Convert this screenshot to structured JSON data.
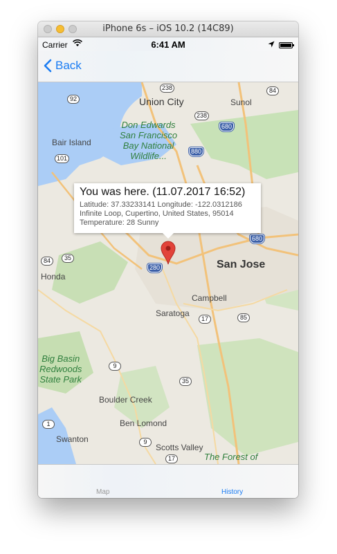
{
  "window": {
    "title": "iPhone 6s – iOS 10.2 (14C89)"
  },
  "status_bar": {
    "carrier": "Carrier",
    "time": "6:41 AM",
    "icons": [
      "wifi-icon",
      "location-arrow-icon",
      "battery-icon"
    ]
  },
  "nav": {
    "back_label": "Back",
    "accent_color": "#1a7cf3"
  },
  "map": {
    "labels": {
      "union_city": "Union City",
      "sunol": "Sunol",
      "don_edwards": "Don Edwards",
      "san_francisco": "San Francisco",
      "bay_national": "Bay National",
      "wildlife": "Wildlife...",
      "bair_island": "Bair Island",
      "san_jose": "San Jose",
      "honda": "Honda",
      "campbell": "Campbell",
      "saratoga": "Saratoga",
      "big_basin": "Big Basin",
      "redwoods": "Redwoods",
      "state_park": "State Park",
      "boulder_creek": "Boulder Creek",
      "ben_lomond": "Ben Lomond",
      "swanton": "Swanton",
      "scotts_valley": "Scotts Valley",
      "forest_of": "The Forest of"
    },
    "shields": {
      "s238a": "238",
      "s84a": "84",
      "s92": "92",
      "s238b": "238",
      "s680a": "680",
      "s880": "880",
      "s101": "101",
      "s280": "280",
      "s680b": "680",
      "s84b": "84",
      "s35a": "35",
      "s17a": "17",
      "s85": "85",
      "s9a": "9",
      "s35b": "35",
      "s1": "1",
      "s9b": "9",
      "s17b": "17"
    },
    "callout": {
      "title": "You was here. (11.07.2017 16:52)",
      "coords": "Latitude: 37.33233141 Longitude: -122.0312186",
      "address": "Infinite Loop, Cupertino, United States, 95014",
      "weather": "Temperature: 28 Sunny"
    },
    "pin_color": "#e2433a"
  },
  "tabs": [
    {
      "label": "Map",
      "selected": false
    },
    {
      "label": "History",
      "selected": true
    }
  ]
}
